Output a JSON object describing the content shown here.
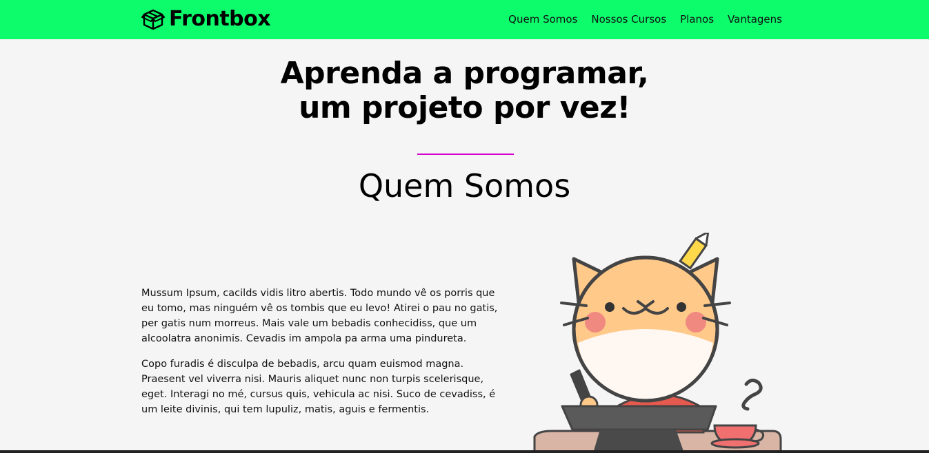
{
  "brand": {
    "name": "Frontbox",
    "icon": "box-icon",
    "accent_color": "#0cfc6c"
  },
  "nav": {
    "items": [
      {
        "label": "Quem Somos"
      },
      {
        "label": "Nossos Cursos"
      },
      {
        "label": "Planos"
      },
      {
        "label": "Vantagens"
      }
    ]
  },
  "hero": {
    "line1": "Aprenda a programar,",
    "line2": "um projeto por vez!"
  },
  "about": {
    "title": "Quem Somos",
    "divider_color": "#d100d1",
    "paragraph1": "Mussum Ipsum, cacilds vidis litro abertis. Todo mundo vê os porris que eu tomo, mas ninguém vê os tombis que eu levo! Atirei o pau no gatis, per gatis num morreus. Mais vale um bebadis conhecidiss, que um alcoolatra anonimis. Cevadis im ampola pa arma uma pindureta.",
    "paragraph2": "Copo furadis é disculpa de bebadis, arcu quam euismod magna. Praesent vel viverra nisi. Mauris aliquet nunc non turpis scelerisque, eget. Interagi no mé, cursus quis, vehicula ac nisi. Suco de cevadiss, é um leite divinis, qui tem lupuliz, matis, aguis e fermentis.",
    "illustration": "cat-programmer-illustration"
  }
}
